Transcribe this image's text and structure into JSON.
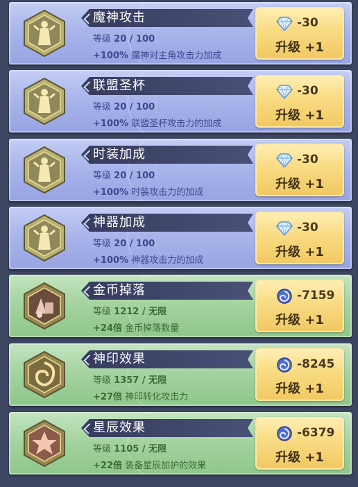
{
  "upgrades": [
    {
      "title": "魔神攻击",
      "level_label": "等级",
      "level": "20 / 100",
      "bonus_value": "+100%",
      "bonus_text": "魔神对主角攻击力加成",
      "cost_icon": "diamond-icon",
      "cost": "-30",
      "button_label": "升级 +1",
      "theme": "blue",
      "emblem": "goddess-emblem"
    },
    {
      "title": "联盟圣杯",
      "level_label": "等级",
      "level": "20 / 100",
      "bonus_value": "+100%",
      "bonus_text": "联盟圣杯攻击力的加成",
      "cost_icon": "diamond-icon",
      "cost": "-30",
      "button_label": "升级 +1",
      "theme": "blue",
      "emblem": "goddess-emblem"
    },
    {
      "title": "时装加成",
      "level_label": "等级",
      "level": "20 / 100",
      "bonus_value": "+100%",
      "bonus_text": "时装攻击力的加成",
      "cost_icon": "diamond-icon",
      "cost": "-30",
      "button_label": "升级 +1",
      "theme": "blue",
      "emblem": "goddess-emblem"
    },
    {
      "title": "神器加成",
      "level_label": "等级",
      "level": "20 / 100",
      "bonus_value": "+100%",
      "bonus_text": "神器攻击力的加成",
      "cost_icon": "diamond-icon",
      "cost": "-30",
      "button_label": "升级 +1",
      "theme": "blue",
      "emblem": "goddess-emblem"
    },
    {
      "title": "金币掉落",
      "level_label": "等级",
      "level": "1212 / 无限",
      "bonus_value": "+24倍",
      "bonus_text": "金币掉落数量",
      "cost_icon": "swirl-orb-icon",
      "cost": "-7159",
      "button_label": "升级 +1",
      "theme": "green",
      "emblem": "loot-emblem"
    },
    {
      "title": "神印效果",
      "level_label": "等级",
      "level": "1357 / 无限",
      "bonus_value": "+27倍",
      "bonus_text": "神印转化攻击力",
      "cost_icon": "swirl-orb-icon",
      "cost": "-8245",
      "button_label": "升级 +1",
      "theme": "green",
      "emblem": "seal-emblem"
    },
    {
      "title": "星辰效果",
      "level_label": "等级",
      "level": "1105 / 无限",
      "bonus_value": "+22倍",
      "bonus_text": "装备星辰加护的效果",
      "cost_icon": "swirl-orb-icon",
      "cost": "-6379",
      "button_label": "升级 +1",
      "theme": "green",
      "emblem": "star-emblem"
    }
  ],
  "colors": {
    "blue_card": "#a7b3ea",
    "green_card": "#a3d29e",
    "title_bar": "#3d4366",
    "button_gold": "#f9dd86"
  }
}
